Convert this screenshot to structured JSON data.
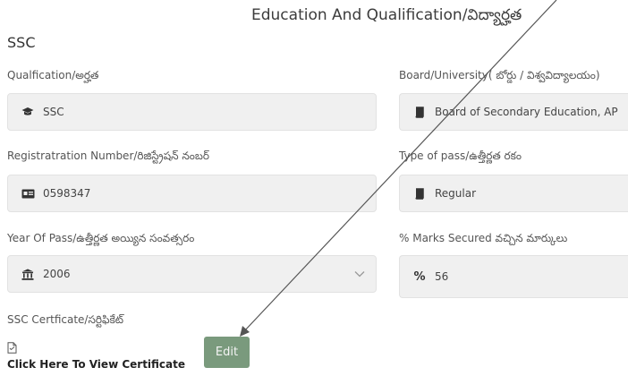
{
  "header": {
    "title": "Education And Qualification/విద్యార్హత"
  },
  "section": {
    "title": "SSC"
  },
  "fields": {
    "qualification": {
      "label": "Qualfication/అర్హత",
      "value": "SSC",
      "icon": "graduation-cap-icon"
    },
    "board": {
      "label": "Board/University( బోర్డు / విశ్వవిద్యాలయం)",
      "value": "Board of Secondary Education, AP",
      "icon": "book-icon"
    },
    "registration": {
      "label": "Registratration Number/రిజిస్ట్రేషన్ నంబర్",
      "value": "0598347",
      "icon": "id-card-icon"
    },
    "pass_type": {
      "label": "Type of pass/ఉత్తీర్ణత రకం",
      "value": "Regular",
      "icon": "book-icon"
    },
    "year": {
      "label": "Year Of Pass/ఉత్తీర్ణత అయ్యిన సంవత్సరం",
      "value": "2006",
      "icon": "institution-icon"
    },
    "marks": {
      "label": "% Marks Secured వచ్చిన మార్కులు",
      "value": "56",
      "icon": "percent-icon"
    }
  },
  "certificate": {
    "label": "SSC Certficate/సర్టిఫికేట్",
    "link_text": "Click Here To View Certificate",
    "icon": "file-icon"
  },
  "actions": {
    "edit_label": "Edit",
    "edit_color": "#7a9a7d"
  },
  "colors": {
    "field_bg": "#f0f0f0",
    "text": "#333333"
  }
}
